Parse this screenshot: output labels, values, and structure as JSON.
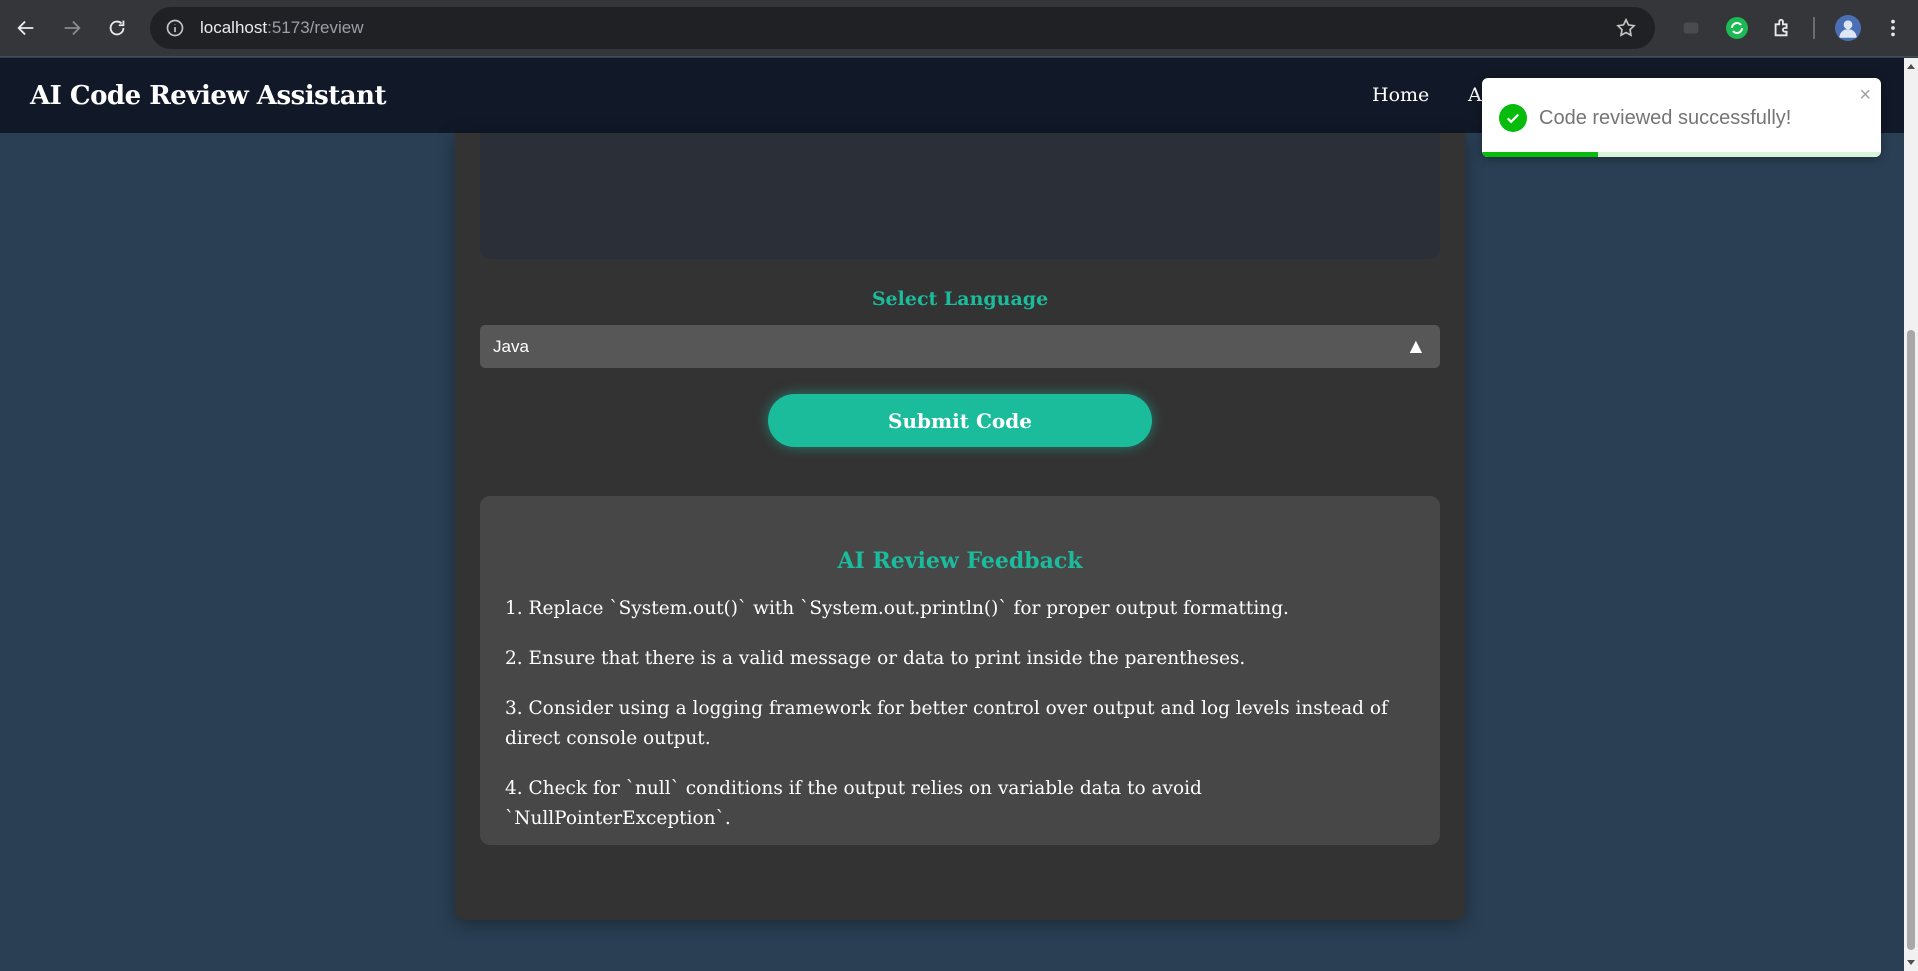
{
  "browser": {
    "url_host": "localhost",
    "url_path": ":5173/review"
  },
  "header": {
    "title": "AI Code Review Assistant",
    "nav": [
      "Home",
      "A"
    ]
  },
  "form": {
    "language_label": "Select Language",
    "language_value": "Java",
    "submit_label": "Submit Code"
  },
  "feedback": {
    "title": "AI Review Feedback",
    "items": [
      "1. Replace `System.out()` with `System.out.println()` for proper output formatting.",
      "2. Ensure that there is a valid message or data to print inside the parentheses.",
      "3. Consider using a logging framework for better control over output and log levels instead of direct console output.",
      "4. Check for `null` conditions if the output relies on variable data to avoid `NullPointerException`."
    ]
  },
  "toast": {
    "message": "Code reviewed successfully!",
    "close_glyph": "×",
    "progress_fraction": 0.29
  },
  "colors": {
    "accent": "#1abc9c",
    "header_bg": "#111827",
    "page_bg": "#2a3f54",
    "card_bg": "#333333",
    "success": "#07bc0c"
  }
}
